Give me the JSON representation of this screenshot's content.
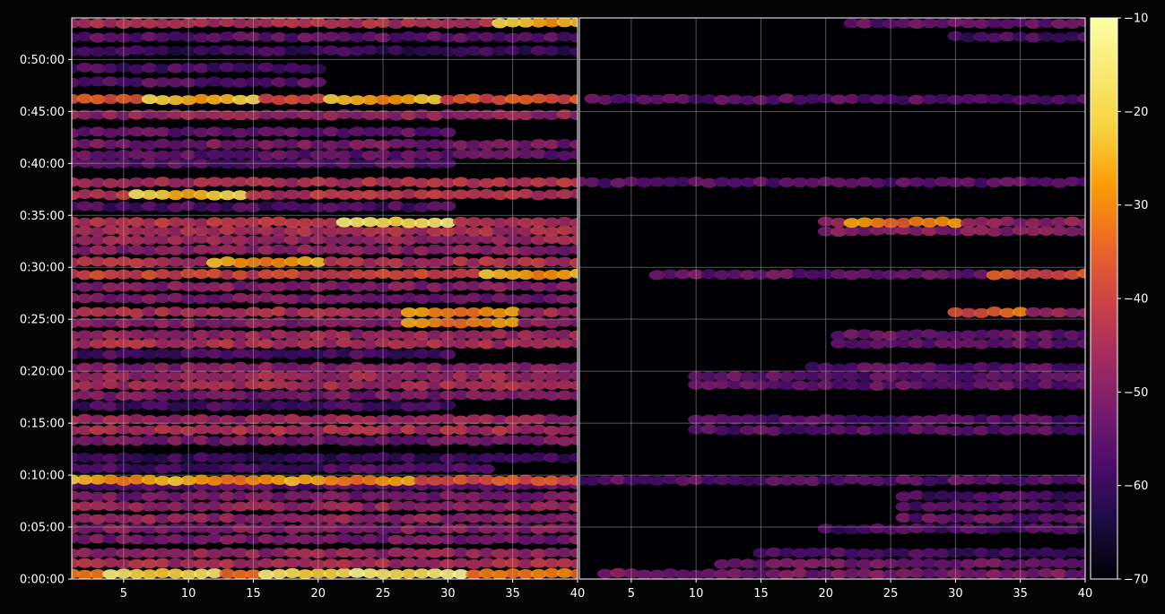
{
  "chart_data": [
    {
      "type": "heatmap",
      "panel": "left",
      "x_ticks": [
        "5",
        "10",
        "15",
        "20",
        "25",
        "30",
        "35",
        "40"
      ],
      "x_tick_values": [
        5,
        10,
        15,
        20,
        25,
        30,
        35,
        40
      ],
      "xlim": [
        1,
        40
      ],
      "y_ticks": [
        "0:00:00",
        "0:05:00",
        "0:10:00",
        "0:15:00",
        "0:20:00",
        "0:25:00",
        "0:30:00",
        "0:35:00",
        "0:40:00",
        "0:45:00",
        "0:50:00"
      ],
      "y_tick_seconds": [
        0,
        300,
        600,
        900,
        1200,
        1500,
        1800,
        2100,
        2400,
        2700,
        3000
      ],
      "ylim_seconds": [
        0,
        3240
      ],
      "grid": true,
      "bands": [
        {
          "t": 30,
          "start": 1,
          "end": 40,
          "level": -33,
          "hot": [
            {
              "x": 8,
              "v": -24
            },
            {
              "x": 20,
              "v": -23
            },
            {
              "x": 27,
              "v": -21
            }
          ]
        },
        {
          "t": 90,
          "start": 1,
          "end": 40,
          "level": -45
        },
        {
          "t": 150,
          "start": 1,
          "end": 40,
          "level": -48
        },
        {
          "t": 230,
          "start": 1,
          "end": 40,
          "level": -52
        },
        {
          "t": 290,
          "start": 1,
          "end": 40,
          "level": -50
        },
        {
          "t": 350,
          "start": 1,
          "end": 40,
          "level": -48
        },
        {
          "t": 420,
          "start": 1,
          "end": 40,
          "level": -48
        },
        {
          "t": 480,
          "start": 1,
          "end": 40,
          "level": -52
        },
        {
          "t": 540,
          "start": 1,
          "end": 40,
          "level": -55
        },
        {
          "t": 570,
          "start": 1,
          "end": 40,
          "level": -38,
          "hot": [
            {
              "x": 5,
              "v": -32
            },
            {
              "x": 14,
              "v": -33
            },
            {
              "x": 23,
              "v": -34
            }
          ]
        },
        {
          "t": 640,
          "start": 1,
          "end": 33,
          "level": -58
        },
        {
          "t": 700,
          "start": 1,
          "end": 40,
          "level": -60
        },
        {
          "t": 800,
          "start": 1,
          "end": 40,
          "level": -52
        },
        {
          "t": 860,
          "start": 1,
          "end": 40,
          "level": -45
        },
        {
          "t": 920,
          "start": 1,
          "end": 40,
          "level": -47
        },
        {
          "t": 1000,
          "start": 1,
          "end": 30,
          "level": -58
        },
        {
          "t": 1060,
          "start": 1,
          "end": 40,
          "level": -52
        },
        {
          "t": 1120,
          "start": 1,
          "end": 40,
          "level": -46
        },
        {
          "t": 1170,
          "start": 1,
          "end": 40,
          "level": -47
        },
        {
          "t": 1220,
          "start": 1,
          "end": 40,
          "level": -50
        },
        {
          "t": 1300,
          "start": 1,
          "end": 30,
          "level": -58
        },
        {
          "t": 1360,
          "start": 1,
          "end": 40,
          "level": -45
        },
        {
          "t": 1410,
          "start": 1,
          "end": 40,
          "level": -47
        },
        {
          "t": 1480,
          "start": 1,
          "end": 40,
          "level": -50,
          "hot": [
            {
              "x": 31,
              "v": -35
            }
          ]
        },
        {
          "t": 1540,
          "start": 1,
          "end": 40,
          "level": -45,
          "hot": [
            {
              "x": 31,
              "v": -34
            }
          ]
        },
        {
          "t": 1620,
          "start": 1,
          "end": 40,
          "level": -52
        },
        {
          "t": 1690,
          "start": 1,
          "end": 40,
          "level": -50
        },
        {
          "t": 1760,
          "start": 1,
          "end": 40,
          "level": -40,
          "hot": [
            {
              "x": 37,
              "v": -30
            }
          ]
        },
        {
          "t": 1830,
          "start": 1,
          "end": 40,
          "level": -44,
          "hot": [
            {
              "x": 16,
              "v": -33
            }
          ]
        },
        {
          "t": 1900,
          "start": 1,
          "end": 40,
          "level": -50
        },
        {
          "t": 1960,
          "start": 1,
          "end": 40,
          "level": -47
        },
        {
          "t": 2010,
          "start": 1,
          "end": 40,
          "level": -45
        },
        {
          "t": 2060,
          "start": 1,
          "end": 40,
          "level": -43,
          "hot": [
            {
              "x": 26,
              "v": -22
            }
          ]
        },
        {
          "t": 2150,
          "start": 1,
          "end": 30,
          "level": -58
        },
        {
          "t": 2220,
          "start": 1,
          "end": 40,
          "level": -43,
          "hot": [
            {
              "x": 10,
              "v": -27
            }
          ]
        },
        {
          "t": 2290,
          "start": 1,
          "end": 40,
          "level": -44
        },
        {
          "t": 2400,
          "start": 1,
          "end": 30,
          "level": -56
        },
        {
          "t": 2450,
          "start": 1,
          "end": 40,
          "level": -55
        },
        {
          "t": 2510,
          "start": 1,
          "end": 40,
          "level": -52
        },
        {
          "t": 2580,
          "start": 1,
          "end": 30,
          "level": -55
        },
        {
          "t": 2680,
          "start": 1,
          "end": 40,
          "level": -48
        },
        {
          "t": 2770,
          "start": 1,
          "end": 40,
          "level": -38,
          "hot": [
            {
              "x": 11,
              "v": -28
            },
            {
              "x": 25,
              "v": -30
            }
          ]
        },
        {
          "t": 2870,
          "start": 1,
          "end": 20,
          "level": -56
        },
        {
          "t": 2950,
          "start": 1,
          "end": 20,
          "level": -58
        },
        {
          "t": 3050,
          "start": 1,
          "end": 40,
          "level": -60
        },
        {
          "t": 3130,
          "start": 1,
          "end": 40,
          "level": -55
        },
        {
          "t": 3210,
          "start": 1,
          "end": 40,
          "level": -45,
          "hot": [
            {
              "x": 38,
              "v": -28
            }
          ]
        }
      ]
    },
    {
      "type": "heatmap",
      "panel": "right",
      "x_ticks": [
        "5",
        "10",
        "15",
        "20",
        "25",
        "30",
        "35",
        "40"
      ],
      "x_tick_values": [
        5,
        10,
        15,
        20,
        25,
        30,
        35,
        40
      ],
      "xlim": [
        1,
        40
      ],
      "ylim_seconds": [
        0,
        3240
      ],
      "grid": true,
      "bands": [
        {
          "t": 30,
          "start": 3,
          "end": 40,
          "level": -52
        },
        {
          "t": 90,
          "start": 12,
          "end": 40,
          "level": -52
        },
        {
          "t": 150,
          "start": 15,
          "end": 40,
          "level": -58
        },
        {
          "t": 290,
          "start": 20,
          "end": 40,
          "level": -58
        },
        {
          "t": 350,
          "start": 26,
          "end": 40,
          "level": -55
        },
        {
          "t": 420,
          "start": 26,
          "end": 40,
          "level": -56
        },
        {
          "t": 480,
          "start": 26,
          "end": 40,
          "level": -58
        },
        {
          "t": 570,
          "start": 1,
          "end": 40,
          "level": -56
        },
        {
          "t": 860,
          "start": 10,
          "end": 40,
          "level": -56
        },
        {
          "t": 920,
          "start": 10,
          "end": 40,
          "level": -57
        },
        {
          "t": 1120,
          "start": 10,
          "end": 40,
          "level": -55
        },
        {
          "t": 1170,
          "start": 10,
          "end": 40,
          "level": -55
        },
        {
          "t": 1220,
          "start": 19,
          "end": 40,
          "level": -56
        },
        {
          "t": 1360,
          "start": 21,
          "end": 40,
          "level": -54
        },
        {
          "t": 1410,
          "start": 21,
          "end": 40,
          "level": -54
        },
        {
          "t": 1540,
          "start": 30,
          "end": 40,
          "level": -48,
          "hot": [
            {
              "x": 31,
              "v": -40
            }
          ]
        },
        {
          "t": 1760,
          "start": 7,
          "end": 40,
          "level": -54,
          "hot": [
            {
              "x": 37,
              "v": -42
            }
          ]
        },
        {
          "t": 2010,
          "start": 20,
          "end": 40,
          "level": -50
        },
        {
          "t": 2060,
          "start": 20,
          "end": 40,
          "level": -48,
          "hot": [
            {
              "x": 26,
              "v": -35
            }
          ]
        },
        {
          "t": 2290,
          "start": 1,
          "end": 40,
          "level": -56
        },
        {
          "t": 2770,
          "start": 2,
          "end": 40,
          "level": -56
        },
        {
          "t": 3130,
          "start": 30,
          "end": 40,
          "level": -58
        },
        {
          "t": 3210,
          "start": 22,
          "end": 40,
          "level": -55
        }
      ]
    }
  ],
  "colorbar": {
    "colormap": "inferno",
    "range": [
      -70,
      -10
    ],
    "ticks": [
      "−10",
      "−20",
      "−30",
      "−40",
      "−50",
      "−60",
      "−70"
    ],
    "tick_values": [
      -10,
      -20,
      -30,
      -40,
      -50,
      -60,
      -70
    ]
  },
  "colors": {
    "background": "#050505",
    "axes_frame": "#ffffff",
    "grid": "#bbbbbb"
  }
}
